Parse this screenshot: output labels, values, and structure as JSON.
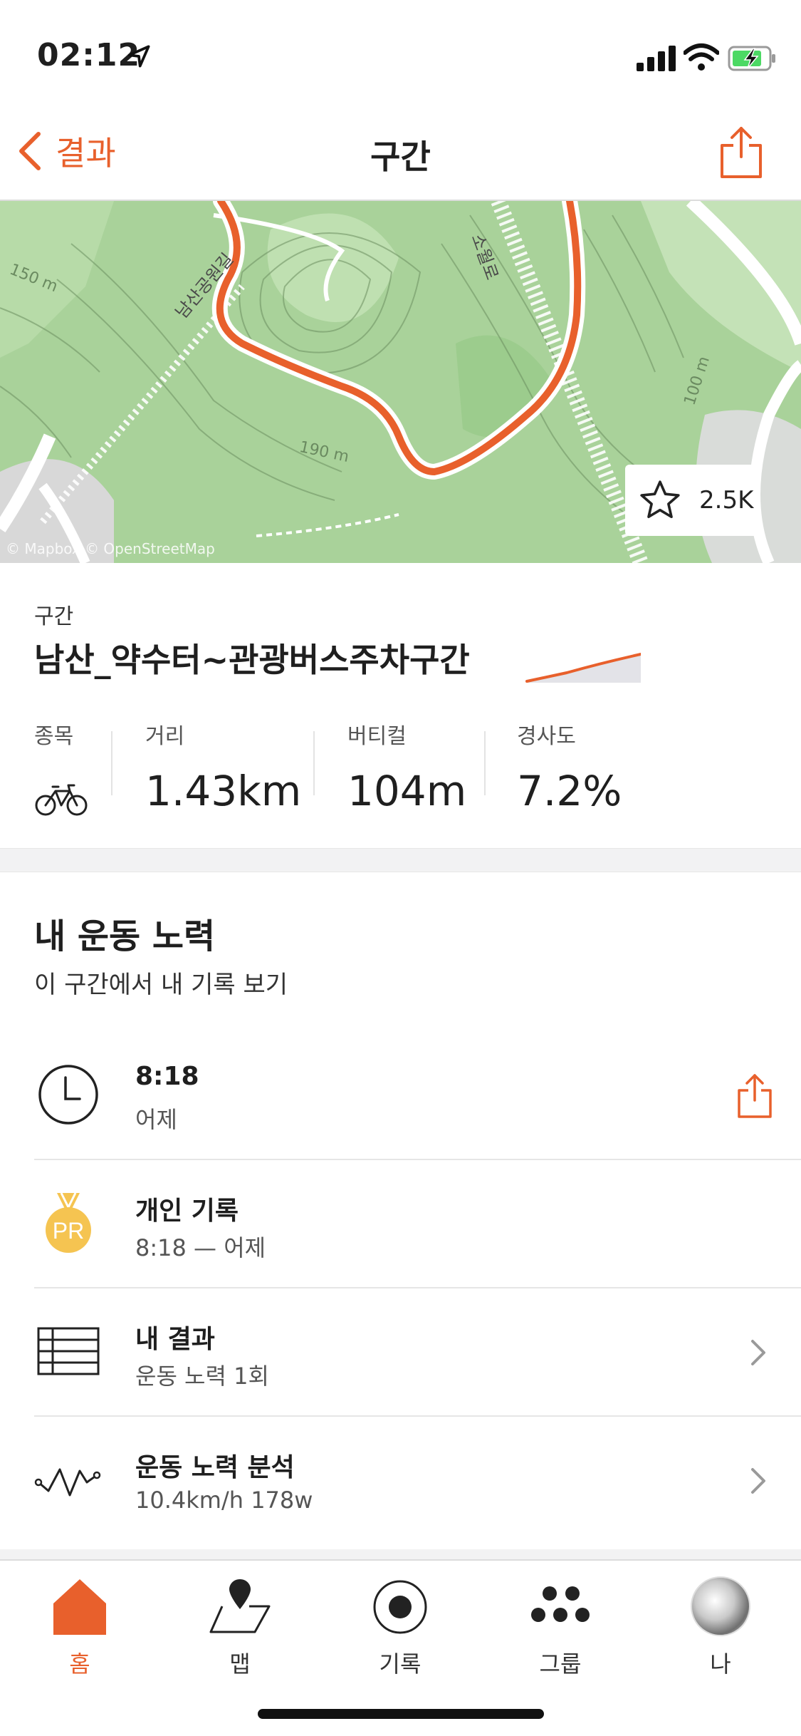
{
  "status_bar": {
    "time": "02:12"
  },
  "nav": {
    "back_label": "결과",
    "title": "구간"
  },
  "map": {
    "star_count": "2.5K",
    "attribution": "© Mapbox © OpenStreetMap",
    "labels": {
      "contour_150": "150 m",
      "contour_190": "190 m",
      "contour_100": "100 m",
      "road_left": "남산공원길",
      "road_right": "소월로"
    },
    "route_color": "#e8602c"
  },
  "segment": {
    "label": "구간",
    "name": "남산_약수터~관광버스주차구간",
    "stats": [
      {
        "label": "종목",
        "icon": "bike-icon"
      },
      {
        "label": "거리",
        "value": "1.43km"
      },
      {
        "label": "버티컬",
        "value": "104m"
      },
      {
        "label": "경사도",
        "value": "7.2%"
      }
    ]
  },
  "efforts": {
    "title": "내 운동 노력",
    "subtitle": "이 구간에서 내 기록 보기",
    "rows": [
      {
        "icon": "clock-icon",
        "title": "8:18",
        "sub": "어제"
      },
      {
        "icon": "pr-medal-icon",
        "title": "개인 기록",
        "sub": "8:18 — 어제",
        "badge": "PR"
      },
      {
        "icon": "table-icon",
        "title": "내 결과",
        "sub": "운동 노력 1회"
      },
      {
        "icon": "analysis-icon",
        "title": "운동 노력 분석",
        "sub": "10.4km/h 178w"
      }
    ]
  },
  "tabs": [
    {
      "label": "홈",
      "icon": "home-icon",
      "active": true
    },
    {
      "label": "맵",
      "icon": "map-icon"
    },
    {
      "label": "기록",
      "icon": "record-icon"
    },
    {
      "label": "그룹",
      "icon": "group-icon"
    },
    {
      "label": "나",
      "icon": "avatar"
    }
  ],
  "colors": {
    "accent": "#e8602c",
    "map_green": "#a9d29a",
    "text": "#1f1f1f"
  }
}
